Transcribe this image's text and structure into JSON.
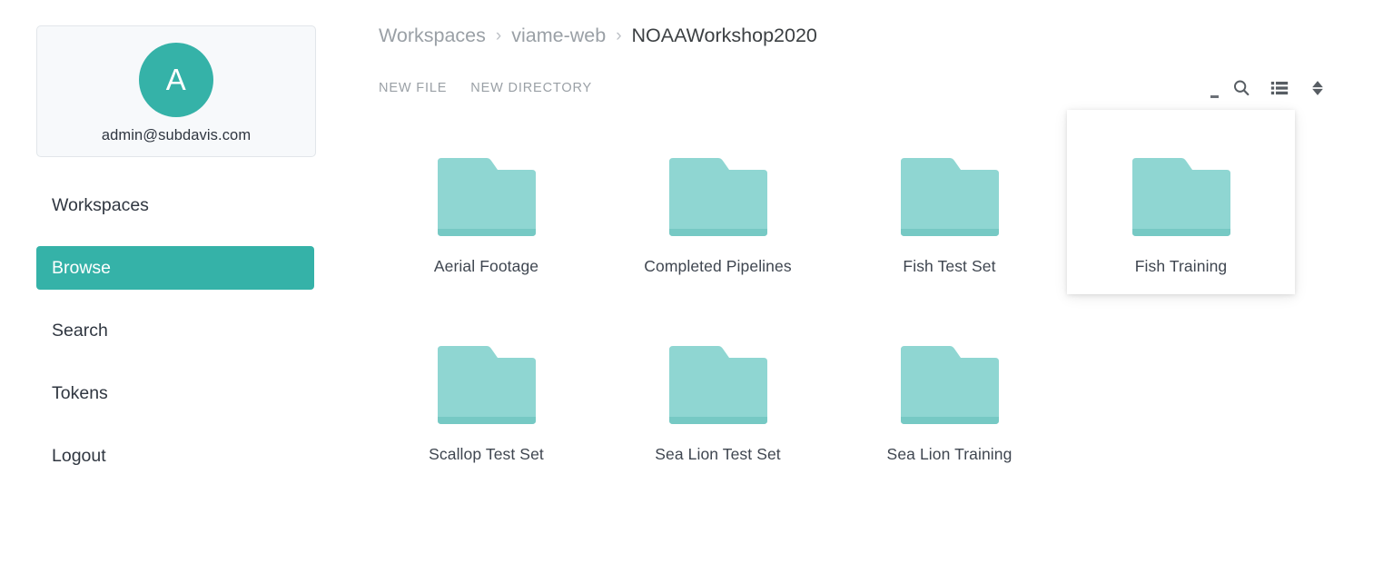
{
  "sidebar": {
    "user": {
      "avatar_initial": "A",
      "email": "admin@subdavis.com",
      "avatar_color": "#35b2a8"
    },
    "items": [
      {
        "label": "Workspaces",
        "active": false
      },
      {
        "label": "Browse",
        "active": true
      },
      {
        "label": "Search",
        "active": false
      },
      {
        "label": "Tokens",
        "active": false
      },
      {
        "label": "Logout",
        "active": false
      }
    ]
  },
  "breadcrumb": {
    "separator": "›",
    "items": [
      {
        "label": "Workspaces",
        "current": false
      },
      {
        "label": "viame-web",
        "current": false
      },
      {
        "label": "NOAAWorkshop2020",
        "current": true
      }
    ]
  },
  "toolbar": {
    "new_file_label": "NEW FILE",
    "new_directory_label": "NEW DIRECTORY",
    "icons": [
      {
        "name": "search-icon"
      },
      {
        "name": "list-view-icon"
      },
      {
        "name": "sort-icon"
      }
    ]
  },
  "grid": {
    "folder_color": "#8fd6d2",
    "folder_base_color": "#76c9c4",
    "items": [
      {
        "label": "Aerial Footage",
        "type": "folder"
      },
      {
        "label": "Completed Pipelines",
        "type": "folder"
      },
      {
        "label": "Fish Test Set",
        "type": "folder"
      },
      {
        "label": "Fish Training",
        "type": "folder"
      },
      {
        "label": "Scallop Test Set",
        "type": "folder"
      },
      {
        "label": "Sea Lion Test Set",
        "type": "folder"
      },
      {
        "label": "Sea Lion Training",
        "type": "folder"
      }
    ]
  }
}
